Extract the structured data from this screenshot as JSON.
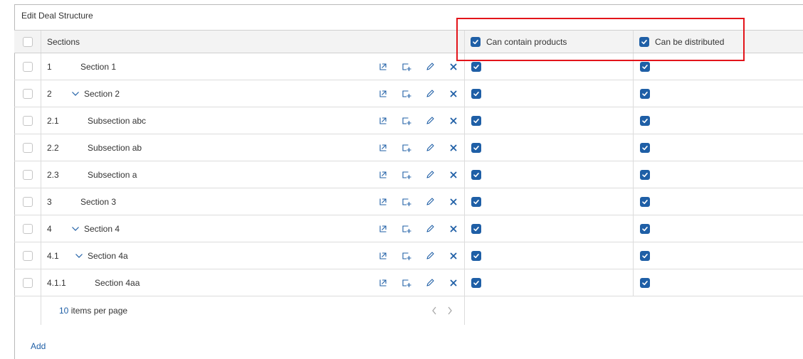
{
  "title": "Edit Deal Structure",
  "columns": {
    "sections": "Sections",
    "can_contain_products": "Can contain products",
    "can_be_distributed": "Can be distributed"
  },
  "rows": [
    {
      "number": "1",
      "name": "Section 1",
      "level": 0,
      "expandable": false,
      "can_contain_products": true,
      "can_be_distributed": true
    },
    {
      "number": "2",
      "name": "Section 2",
      "level": 0,
      "expandable": true,
      "can_contain_products": true,
      "can_be_distributed": true
    },
    {
      "number": "2.1",
      "name": "Subsection abc",
      "level": 1,
      "expandable": false,
      "can_contain_products": true,
      "can_be_distributed": true
    },
    {
      "number": "2.2",
      "name": "Subsection ab",
      "level": 1,
      "expandable": false,
      "can_contain_products": true,
      "can_be_distributed": true
    },
    {
      "number": "2.3",
      "name": "Subsection a",
      "level": 1,
      "expandable": false,
      "can_contain_products": true,
      "can_be_distributed": true
    },
    {
      "number": "3",
      "name": "Section 3",
      "level": 0,
      "expandable": false,
      "can_contain_products": true,
      "can_be_distributed": true
    },
    {
      "number": "4",
      "name": "Section 4",
      "level": 0,
      "expandable": true,
      "can_contain_products": true,
      "can_be_distributed": true
    },
    {
      "number": "4.1",
      "name": "Section 4a",
      "level": 1,
      "expandable": true,
      "can_contain_products": true,
      "can_be_distributed": true
    },
    {
      "number": "4.1.1",
      "name": "Section 4aa",
      "level": 2,
      "expandable": false,
      "can_contain_products": true,
      "can_be_distributed": true
    }
  ],
  "row_actions": [
    "move-icon",
    "add-subsection-icon",
    "edit-pencil-icon",
    "delete-x-icon"
  ],
  "pagination": {
    "page_size": "10",
    "page_size_suffix": " items per page"
  },
  "add_label": "Add",
  "colors": {
    "accent": "#1f5fa6",
    "highlight": "#e3141a"
  }
}
